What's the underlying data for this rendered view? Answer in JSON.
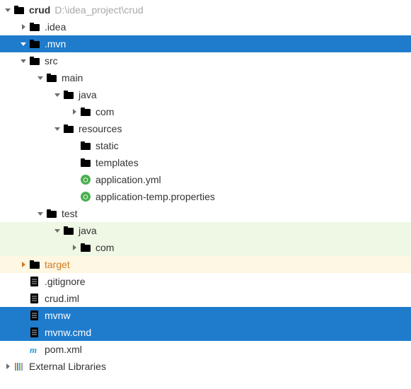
{
  "root": {
    "name": "crud",
    "path": "D:\\idea_project\\crud"
  },
  "nodes": {
    "idea": ".idea",
    "mvn": ".mvn",
    "src": "src",
    "main": "main",
    "java_main": "java",
    "com_main": "com",
    "resources": "resources",
    "static": "static",
    "templates": "templates",
    "app_yml": "application.yml",
    "app_temp": "application-temp.properties",
    "test": "test",
    "java_test": "java",
    "com_test": "com",
    "target": "target",
    "gitignore": ".gitignore",
    "crud_iml": "crud.iml",
    "mvnw": "mvnw",
    "mvnw_cmd": "mvnw.cmd",
    "pom": "pom.xml",
    "ext_lib": "External Libraries"
  }
}
